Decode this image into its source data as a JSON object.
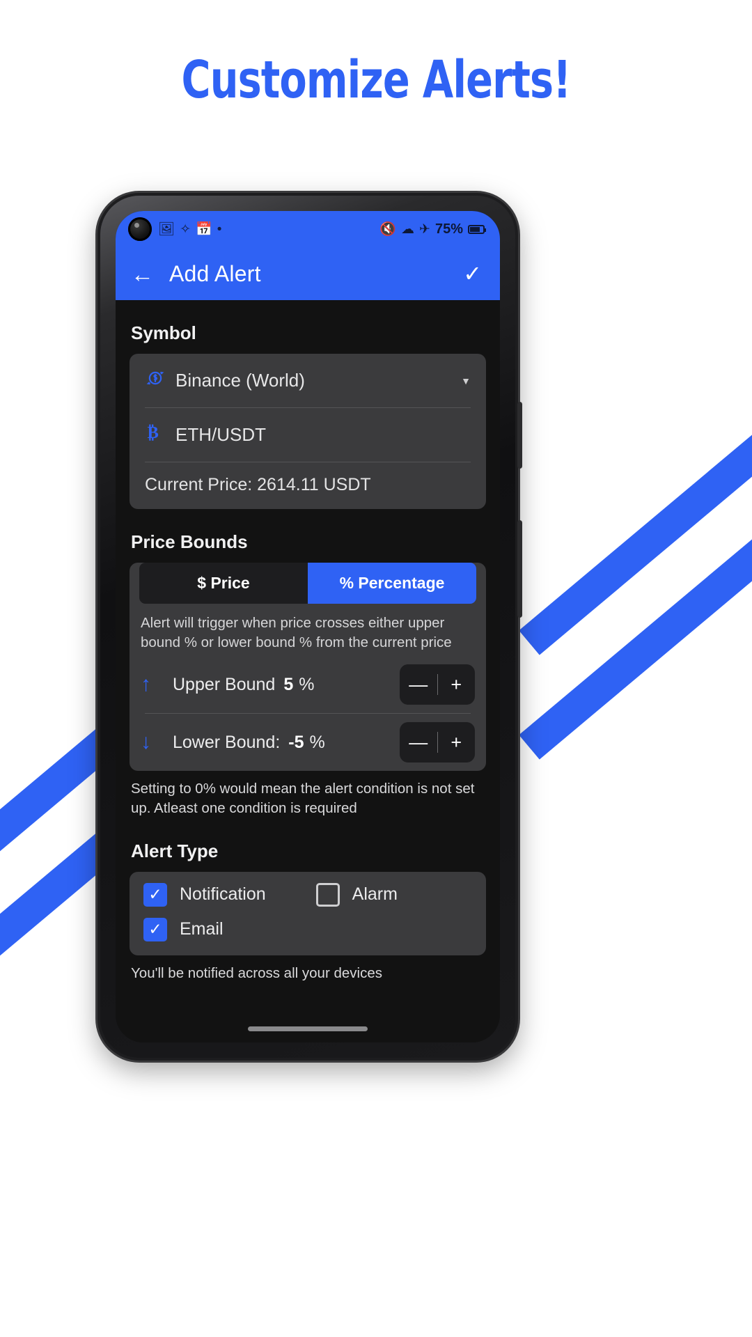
{
  "promo": {
    "headline": "Customize Alerts!"
  },
  "status_bar": {
    "left_icons": [
      "photo-icon",
      "fan-icon",
      "calendar-icon",
      "dot-icon"
    ],
    "right_icons": [
      "mute-icon",
      "wifi-icon",
      "airplane-icon"
    ],
    "battery_percent": "75%"
  },
  "app_bar": {
    "back_label": "←",
    "title": "Add Alert",
    "confirm_label": "✓"
  },
  "symbol_section": {
    "title": "Symbol",
    "exchange": "Binance (World)",
    "exchange_icon": "currency-sync-icon",
    "pair": "ETH/USDT",
    "pair_icon": "bitcoin-icon",
    "current_price": "Current Price: 2614.11 USDT",
    "dropdown_icon": "chevron-down-icon"
  },
  "price_bounds_section": {
    "title": "Price Bounds",
    "tab_price": "$ Price",
    "tab_percentage": "% Percentage",
    "selected_tab": "% Percentage",
    "hint": "Alert will trigger when price crosses either upper bound % or lower bound % from the current price",
    "upper": {
      "arrow_icon": "arrow-up-icon",
      "label": "Upper Bound",
      "value": "5",
      "unit": "%",
      "minus": "—",
      "plus": "+"
    },
    "lower": {
      "arrow_icon": "arrow-down-icon",
      "label": "Lower Bound:",
      "value": "-5",
      "unit": "%",
      "minus": "—",
      "plus": "+"
    },
    "note": "Setting to 0% would mean the alert condition is not set up. Atleast one condition is required"
  },
  "alert_type_section": {
    "title": "Alert Type",
    "options": [
      {
        "label": "Notification",
        "checked": true
      },
      {
        "label": "Alarm",
        "checked": false
      },
      {
        "label": "Email",
        "checked": true
      }
    ],
    "footnote": "You'll be notified across all your devices"
  },
  "colors": {
    "accent": "#2F62F4",
    "surface": "#3b3b3d",
    "background": "#121212"
  }
}
